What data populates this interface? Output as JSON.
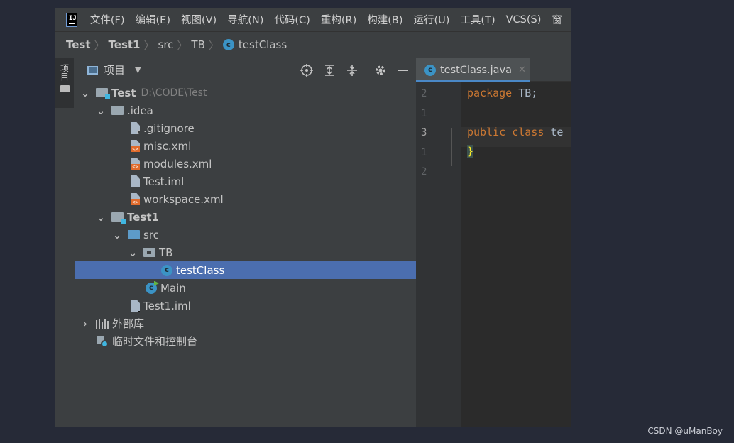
{
  "menu": [
    "文件(F)",
    "编辑(E)",
    "视图(V)",
    "导航(N)",
    "代码(C)",
    "重构(R)",
    "构建(B)",
    "运行(U)",
    "工具(T)",
    "VCS(S)",
    "窗"
  ],
  "logo_text": "IJ",
  "breadcrumb": [
    "Test",
    "Test1",
    "src",
    "TB",
    "testClass"
  ],
  "toolwindow_tab": "项目",
  "panel": {
    "title": "项目"
  },
  "tree": [
    {
      "label": "Test",
      "extra": "D:\\CODE\\Test",
      "bold": true,
      "icon": "module-folder-icon",
      "depth": 0,
      "arrow": "expanded"
    },
    {
      "label": ".idea",
      "icon": "folder-icon",
      "depth": 1,
      "arrow": "expanded"
    },
    {
      "label": ".gitignore",
      "icon": "gitignore-file-icon",
      "depth": 2
    },
    {
      "label": "misc.xml",
      "icon": "xml-file-icon",
      "depth": 2
    },
    {
      "label": "modules.xml",
      "icon": "xml-file-icon",
      "depth": 2
    },
    {
      "label": "Test.iml",
      "icon": "iml-file-icon",
      "depth": 2
    },
    {
      "label": "workspace.xml",
      "icon": "xml-file-icon",
      "depth": 2
    },
    {
      "label": "Test1",
      "bold": true,
      "icon": "module-folder-icon",
      "depth": 1,
      "arrow": "expanded"
    },
    {
      "label": "src",
      "icon": "source-folder-icon",
      "depth": 2,
      "arrow": "expanded"
    },
    {
      "label": "TB",
      "icon": "package-icon",
      "depth": 3,
      "arrow": "expanded"
    },
    {
      "label": "testClass",
      "icon": "java-class-icon",
      "depth": 4,
      "selected": true
    },
    {
      "label": "Main",
      "icon": "java-main-class-icon",
      "depth": 3
    },
    {
      "label": "Test1.iml",
      "icon": "iml-file-icon",
      "depth": 2
    },
    {
      "label": "外部库",
      "icon": "libraries-icon",
      "depth": 0,
      "arrow": "collapsed"
    },
    {
      "label": "临时文件和控制台",
      "icon": "scratches-icon",
      "depth": 0
    }
  ],
  "editor": {
    "tab": "testClass.java",
    "line_numbers": [
      "2",
      "1",
      "3",
      "1",
      "2"
    ],
    "lines": [
      {
        "kw": "package",
        "rest": " TB;"
      },
      {
        "kw": "",
        "rest": ""
      },
      {
        "kw": "public class",
        "rest": " te"
      },
      {
        "brace": "}"
      },
      {
        "kw": "",
        "rest": ""
      }
    ]
  },
  "watermark": "CSDN @uManBoy",
  "colors": {
    "selection": "#4b6eaf",
    "keyword": "#cc7832",
    "class_icon": "#3b93c5",
    "tab_underline": "#4a88c7"
  }
}
